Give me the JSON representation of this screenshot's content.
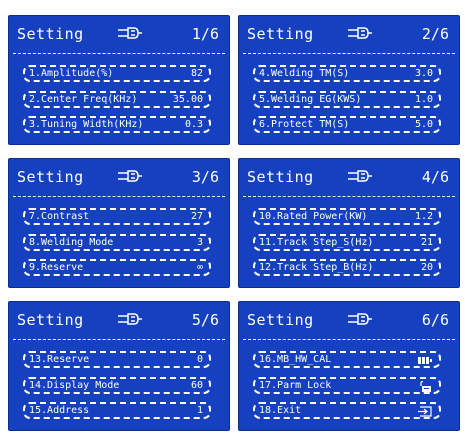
{
  "screens": [
    {
      "title": "Setting",
      "page": "1/6",
      "rows": [
        {
          "label": "1.Amplitude(%)",
          "value": "82"
        },
        {
          "label": "2.Center Freq(KHz)",
          "value": "35.00"
        },
        {
          "label": "3.Tuning Width(KHz)",
          "value": "0.3"
        }
      ]
    },
    {
      "title": "Setting",
      "page": "2/6",
      "rows": [
        {
          "label": "4.Welding TM(S)",
          "value": "3.0"
        },
        {
          "label": "5.Welding EG(KWS)",
          "value": "1.0"
        },
        {
          "label": "6.Protect TM(S)",
          "value": "5.0"
        }
      ]
    },
    {
      "title": "Setting",
      "page": "3/6",
      "rows": [
        {
          "label": "7.Contrast",
          "value": "27"
        },
        {
          "label": "8.Welding Mode",
          "value": "3"
        },
        {
          "label": "9.Reserve",
          "value": "∞"
        }
      ]
    },
    {
      "title": "Setting",
      "page": "4/6",
      "rows": [
        {
          "label": "10.Rated Power(KW)",
          "value": "1.2"
        },
        {
          "label": "11.Track Step_S(Hz)",
          "value": "21"
        },
        {
          "label": "12.Track Step_B(Hz)",
          "value": "20"
        }
      ]
    },
    {
      "title": "Setting",
      "page": "5/6",
      "rows": [
        {
          "label": "13.Reserve",
          "value": "0"
        },
        {
          "label": "14.Display Mode",
          "value": "60"
        },
        {
          "label": "15.Address",
          "value": "1"
        }
      ]
    },
    {
      "title": "Setting",
      "page": "6/6",
      "rows": [
        {
          "label": "16.MB_HW_CAL",
          "icon": "battery-icon"
        },
        {
          "label": "17.Parm Lock",
          "icon": "lock-icon"
        },
        {
          "label": "18.Exit",
          "icon": "exit-icon"
        }
      ]
    }
  ],
  "header_icon": "plug-icon",
  "colors": {
    "screen_bg": "#1540bf",
    "text": "#ffffff",
    "page_bg": "#ffffff"
  }
}
